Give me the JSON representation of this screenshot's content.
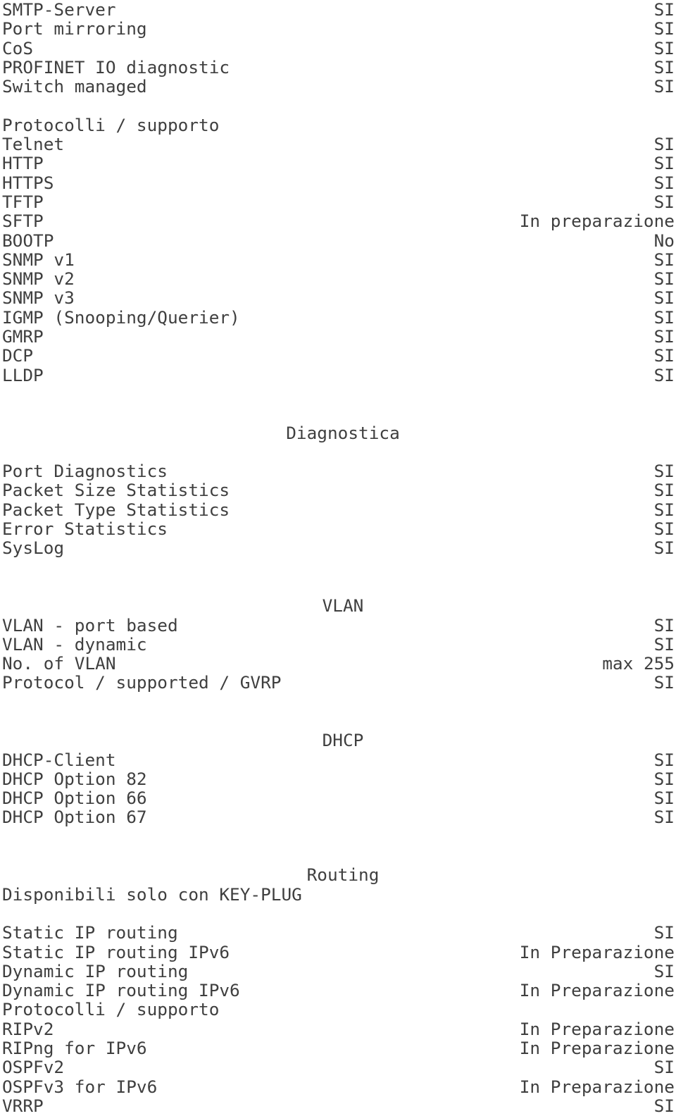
{
  "document": {
    "type": "product-specification-sheet",
    "language": "it",
    "text_color": "#3f3f3f",
    "background_color": "#ffffff"
  },
  "blocks": [
    {
      "kind": "rows",
      "rows": [
        {
          "label": "SMTP-Server",
          "value": "SI"
        },
        {
          "label": "Port mirroring",
          "value": "SI"
        },
        {
          "label": "CoS",
          "value": "SI"
        },
        {
          "label": "PROFINET IO diagnostic",
          "value": "SI"
        },
        {
          "label": "Switch managed",
          "value": "SI"
        }
      ]
    },
    {
      "kind": "spacer"
    },
    {
      "kind": "rows",
      "rows": [
        {
          "label": "Protocolli / supporto",
          "value": ""
        },
        {
          "label": "Telnet",
          "value": "SI"
        },
        {
          "label": "HTTP",
          "value": "SI"
        },
        {
          "label": "HTTPS",
          "value": "SI"
        },
        {
          "label": "TFTP",
          "value": "SI"
        },
        {
          "label": "SFTP",
          "value": "In preparazione"
        },
        {
          "label": "BOOTP",
          "value": "No"
        },
        {
          "label": "SNMP v1",
          "value": "SI"
        },
        {
          "label": "SNMP v2",
          "value": "SI"
        },
        {
          "label": "SNMP v3",
          "value": "SI"
        },
        {
          "label": "IGMP (Snooping/Querier)",
          "value": "SI"
        },
        {
          "label": "GMRP",
          "value": "SI"
        },
        {
          "label": "DCP",
          "value": "SI"
        },
        {
          "label": "LLDP",
          "value": "SI"
        }
      ]
    },
    {
      "kind": "spacer"
    },
    {
      "kind": "spacer"
    },
    {
      "kind": "heading",
      "title": "Diagnostica"
    },
    {
      "kind": "spacer"
    },
    {
      "kind": "rows",
      "rows": [
        {
          "label": "Port Diagnostics",
          "value": "SI"
        },
        {
          "label": "Packet Size Statistics",
          "value": "SI"
        },
        {
          "label": "Packet Type Statistics",
          "value": "SI"
        },
        {
          "label": "Error Statistics",
          "value": "SI"
        },
        {
          "label": "SysLog",
          "value": "SI"
        }
      ]
    },
    {
      "kind": "spacer"
    },
    {
      "kind": "spacer"
    },
    {
      "kind": "heading",
      "title": "VLAN"
    },
    {
      "kind": "rows",
      "rows": [
        {
          "label": "VLAN - port based",
          "value": "SI"
        },
        {
          "label": "VLAN - dynamic",
          "value": "SI"
        },
        {
          "label": "No. of VLAN",
          "value": "max 255"
        },
        {
          "label": "Protocol / supported / GVRP",
          "value": "SI"
        }
      ]
    },
    {
      "kind": "spacer"
    },
    {
      "kind": "spacer"
    },
    {
      "kind": "heading",
      "title": "DHCP"
    },
    {
      "kind": "rows",
      "rows": [
        {
          "label": "DHCP-Client",
          "value": "SI"
        },
        {
          "label": "DHCP Option 82",
          "value": "SI"
        },
        {
          "label": "DHCP Option 66",
          "value": "SI"
        },
        {
          "label": "DHCP Option 67",
          "value": "SI"
        }
      ]
    },
    {
      "kind": "spacer"
    },
    {
      "kind": "spacer"
    },
    {
      "kind": "heading",
      "title": "Routing"
    },
    {
      "kind": "rows",
      "rows": [
        {
          "label": "Disponibili solo con KEY-PLUG",
          "value": ""
        }
      ]
    },
    {
      "kind": "spacer"
    },
    {
      "kind": "rows",
      "rows": [
        {
          "label": "Static IP routing",
          "value": "SI"
        },
        {
          "label": "Static IP routing IPv6",
          "value": "In Preparazione"
        },
        {
          "label": "Dynamic IP routing",
          "value": "SI"
        },
        {
          "label": "Dynamic IP routing IPv6",
          "value": "In Preparazione"
        },
        {
          "label": "Protocolli / supporto",
          "value": ""
        },
        {
          "label": "RIPv2",
          "value": "In Preparazione"
        },
        {
          "label": "RIPng for IPv6",
          "value": "In Preparazione"
        },
        {
          "label": "OSPFv2",
          "value": "SI"
        },
        {
          "label": "OSPFv3 for IPv6",
          "value": "In Preparazione"
        },
        {
          "label": "VRRP",
          "value": "SI"
        }
      ]
    }
  ]
}
